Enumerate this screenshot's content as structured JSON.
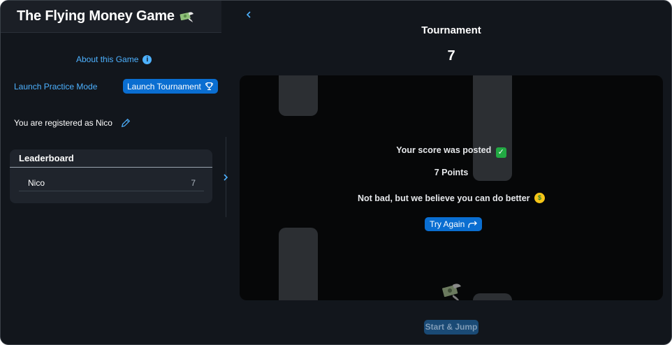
{
  "sidebar": {
    "app_title": "The Flying Money Game",
    "about_link": "About this Game",
    "practice_link": "Launch Practice Mode",
    "tournament_button": "Launch Tournament",
    "registered_text": "You are registered as Nico",
    "leaderboard": {
      "title": "Leaderboard",
      "rows": [
        {
          "name": "Nico",
          "score": "7"
        }
      ]
    }
  },
  "main": {
    "title": "Tournament",
    "score": "7",
    "result": {
      "posted": "Your score was posted",
      "points": "7 Points",
      "feedback": "Not bad, but we believe you can do better",
      "try_again": "Try Again"
    },
    "start_jump": "Start & Jump"
  },
  "colors": {
    "accent": "#0a6ed1",
    "link": "#4db1ff",
    "background": "#12161c",
    "canvas": "#060708"
  },
  "icons": {
    "back": "chevron-left-icon",
    "info": "info-icon",
    "trophy": "trophy-icon",
    "edit": "pencil-icon",
    "expand": "chevron-right-icon",
    "retry": "share-arrow-icon"
  }
}
